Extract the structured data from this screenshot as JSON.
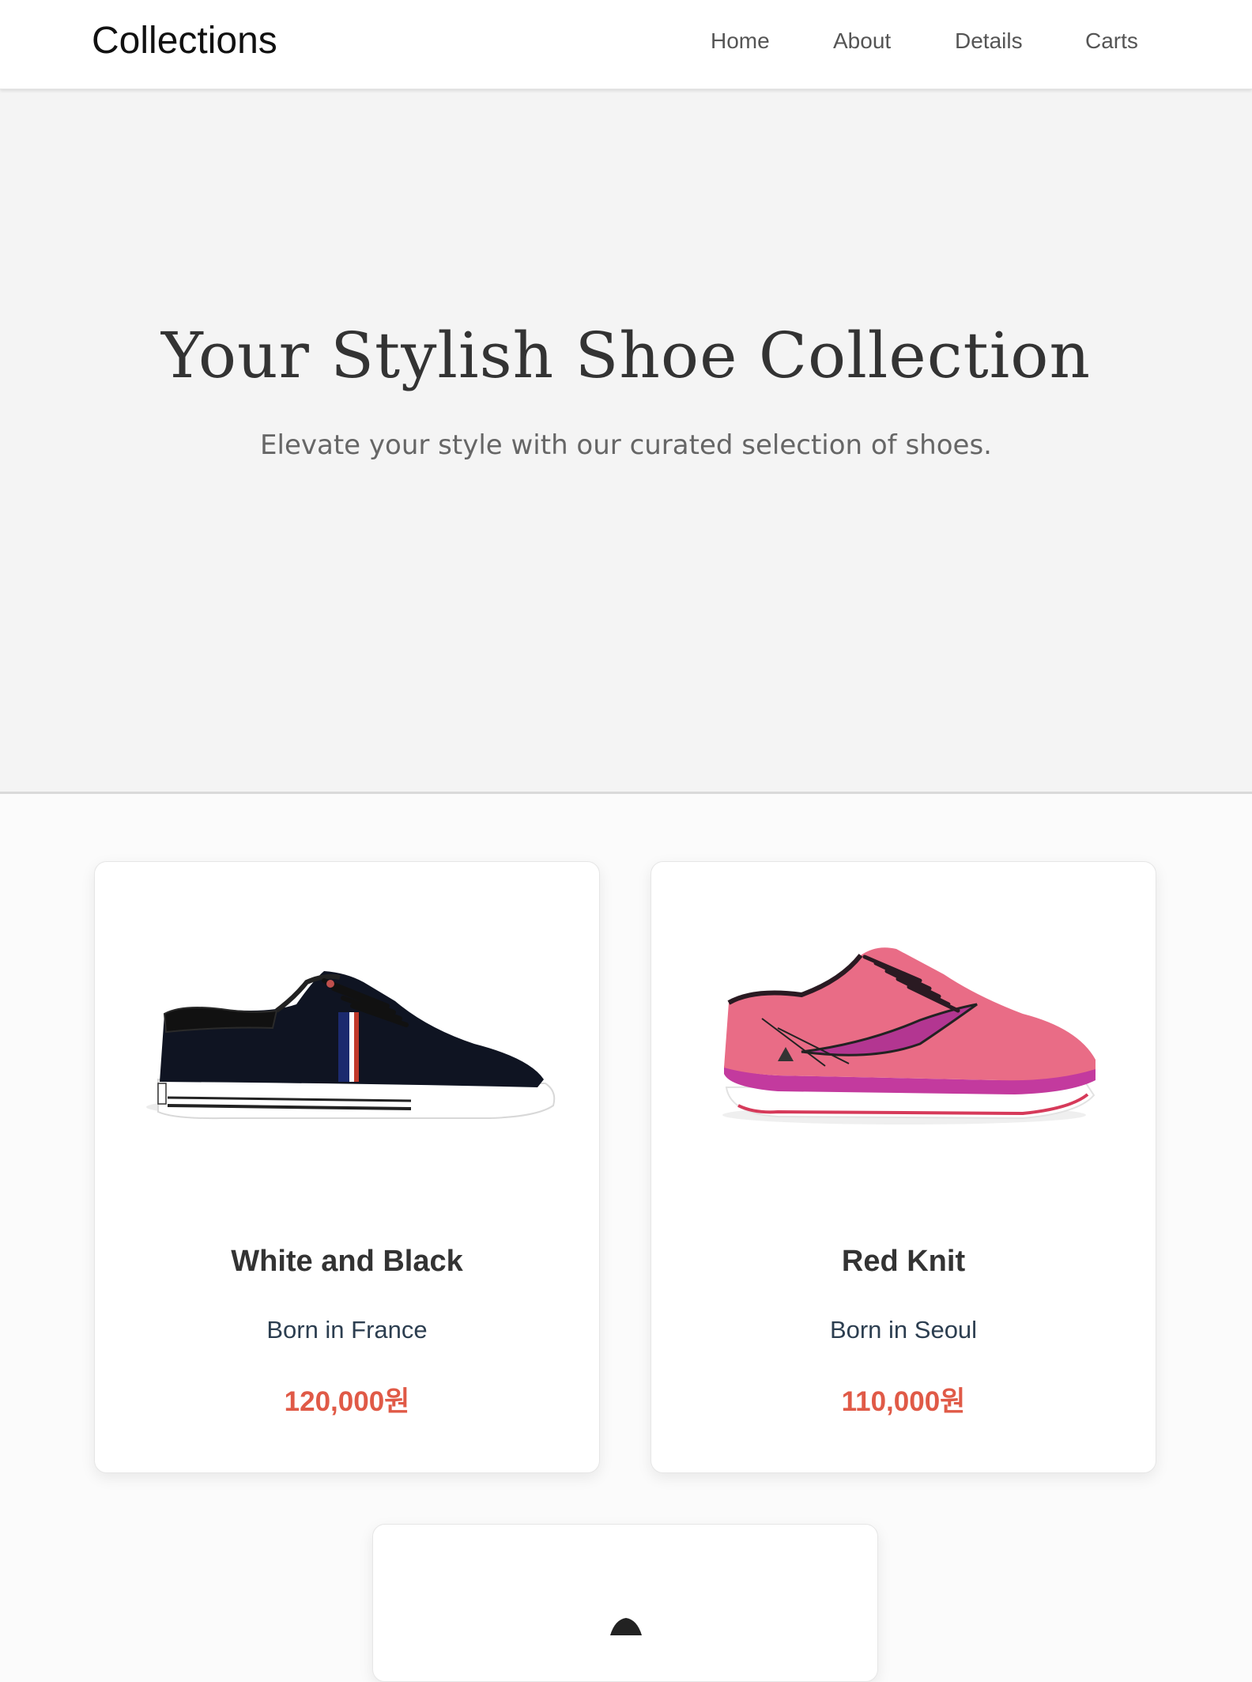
{
  "nav": {
    "brand": "Collections",
    "links": [
      "Home",
      "About",
      "Details",
      "Carts"
    ]
  },
  "hero": {
    "title": "Your Stylish Shoe Collection",
    "subtitle": "Elevate your style with our curated selection of shoes."
  },
  "products": [
    {
      "name": "White and Black",
      "origin": "Born in France",
      "price": "120,000원",
      "image_icon": "black-sneaker-image"
    },
    {
      "name": "Red Knit",
      "origin": "Born in Seoul",
      "price": "110,000원",
      "image_icon": "pink-running-shoe-image"
    }
  ],
  "colors": {
    "price": "#e05a47",
    "hero_bg": "#f4f4f4",
    "nav_bg": "#ffffff",
    "title": "#333333"
  }
}
